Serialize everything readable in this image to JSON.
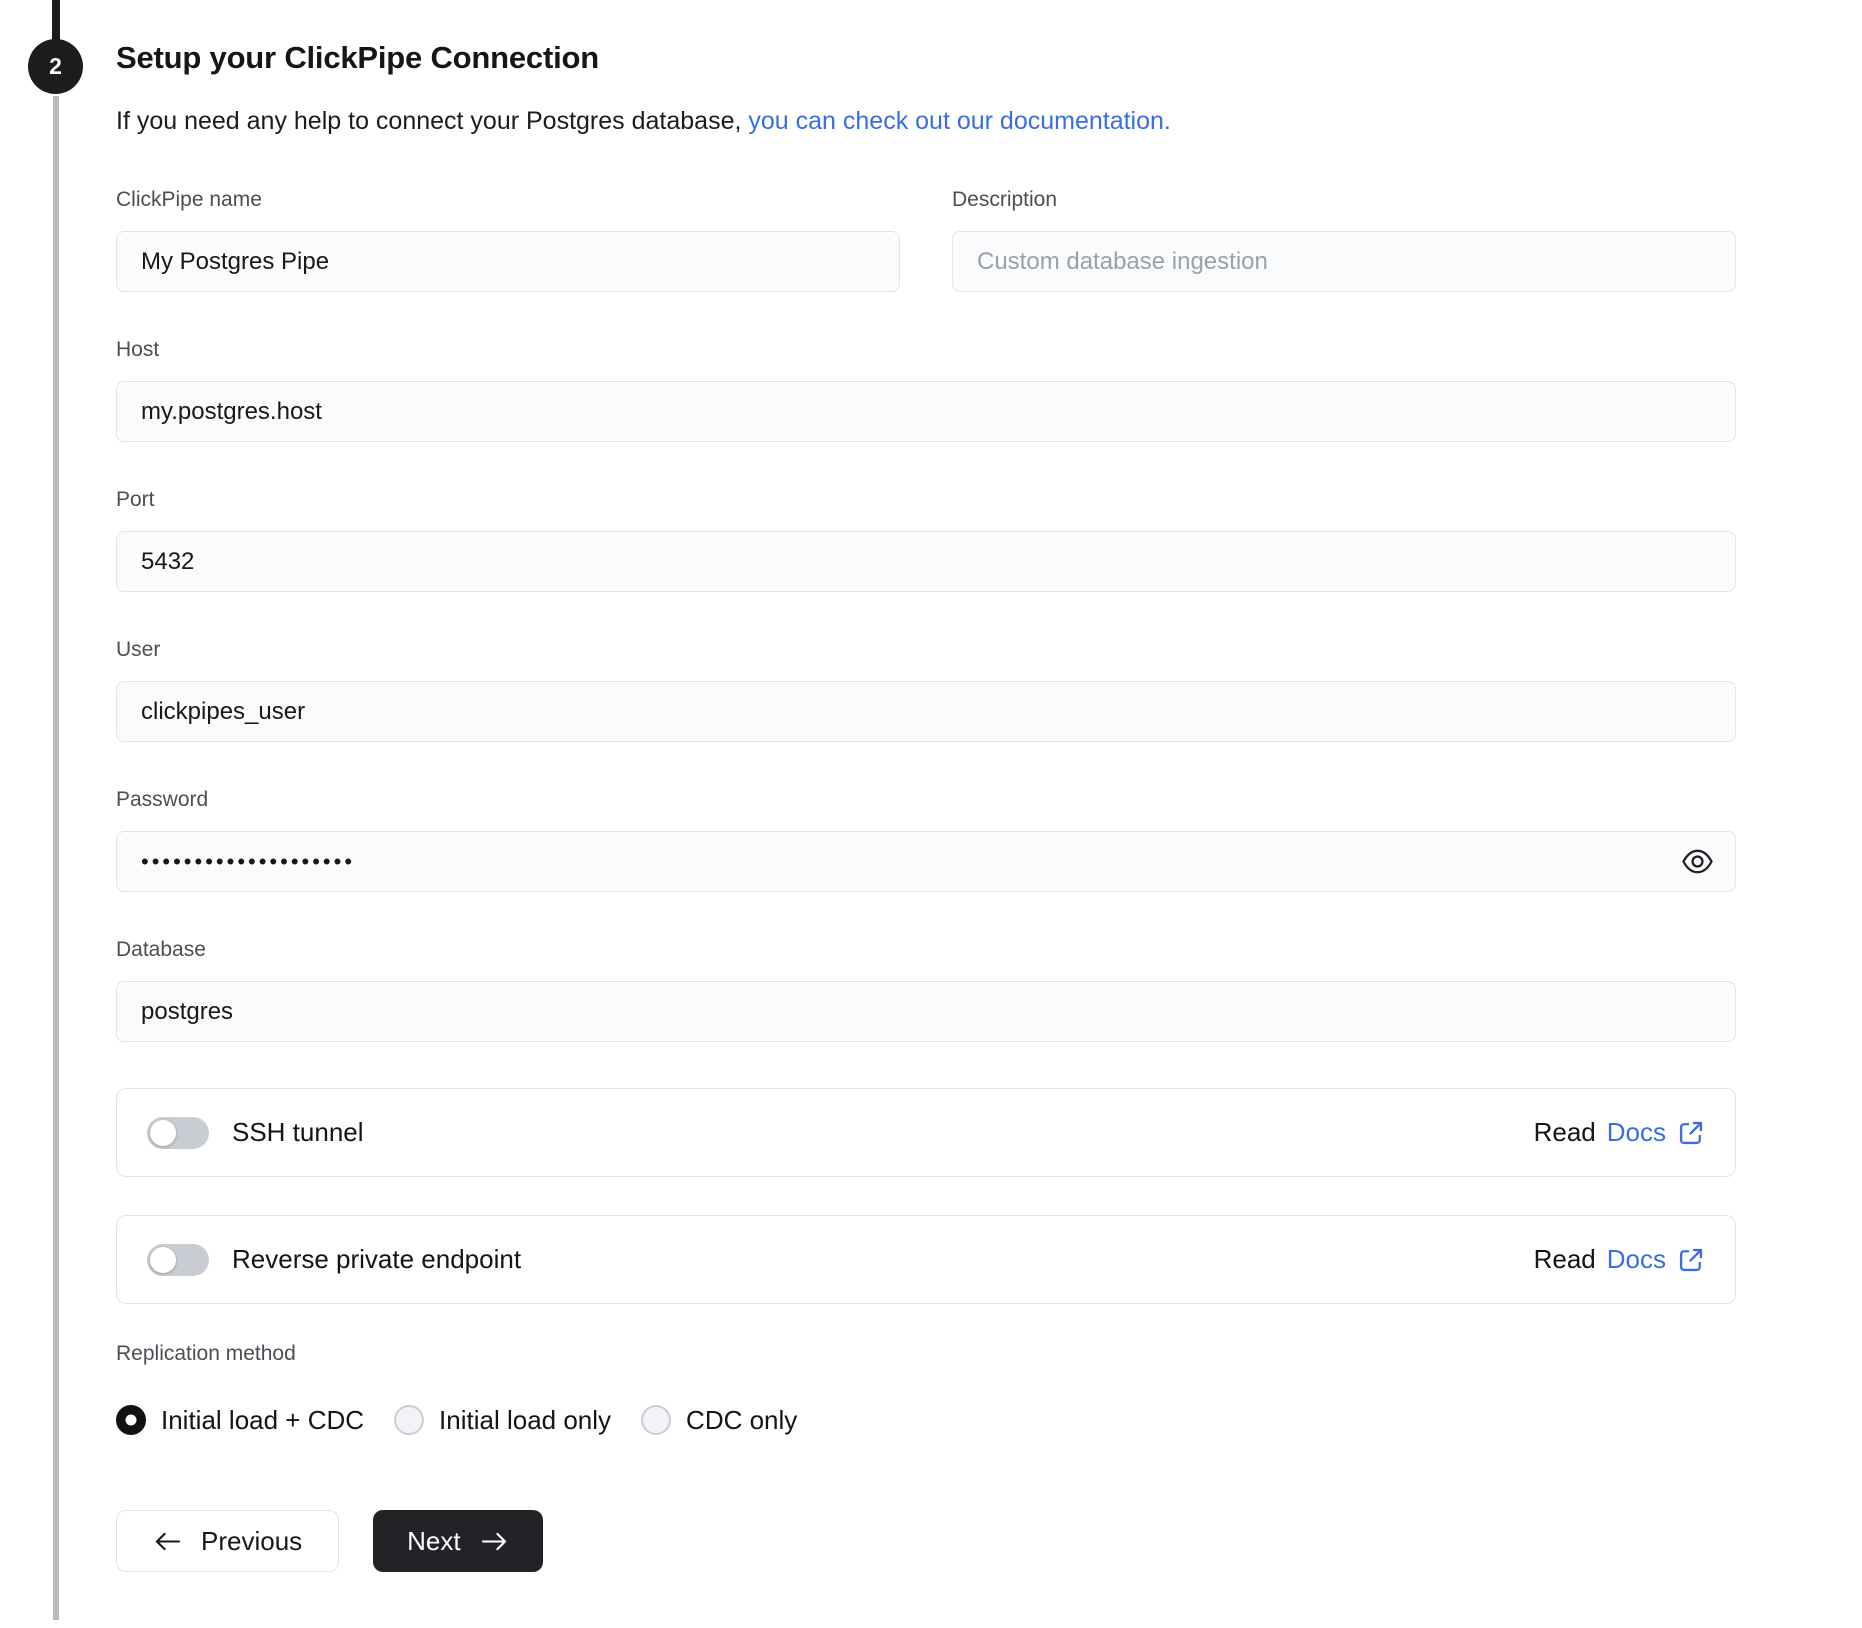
{
  "step": {
    "number": "2"
  },
  "header": {
    "title": "Setup your ClickPipe Connection",
    "subtitle_text": "If you need any help to connect your Postgres database, ",
    "subtitle_link": "you can check out our documentation."
  },
  "fields": {
    "clickpipe_name": {
      "label": "ClickPipe name",
      "value": "My Postgres Pipe"
    },
    "description": {
      "label": "Description",
      "placeholder": "Custom database ingestion"
    },
    "host": {
      "label": "Host",
      "value": "my.postgres.host"
    },
    "port": {
      "label": "Port",
      "value": "5432"
    },
    "user": {
      "label": "User",
      "value": "clickpipes_user"
    },
    "password": {
      "label": "Password",
      "value_masked": "••••••••••••••••••••"
    },
    "database": {
      "label": "Database",
      "value": "postgres"
    }
  },
  "toggles": [
    {
      "label": "SSH tunnel",
      "state": "off",
      "read_text": "Read",
      "docs_link_text": "Docs"
    },
    {
      "label": "Reverse private endpoint",
      "state": "off",
      "read_text": "Read",
      "docs_link_text": "Docs"
    }
  ],
  "replication": {
    "label": "Replication method",
    "options": [
      {
        "label": "Initial load + CDC",
        "selected": true
      },
      {
        "label": "Initial load only",
        "selected": false
      },
      {
        "label": "CDC only",
        "selected": false
      }
    ]
  },
  "buttons": {
    "previous": "Previous",
    "next": "Next"
  },
  "colors": {
    "accent_blue": "#3a6ee0",
    "dark": "#1c1c1e",
    "toggle_off": "#c9cdd3",
    "input_bg": "#fafbfd"
  }
}
